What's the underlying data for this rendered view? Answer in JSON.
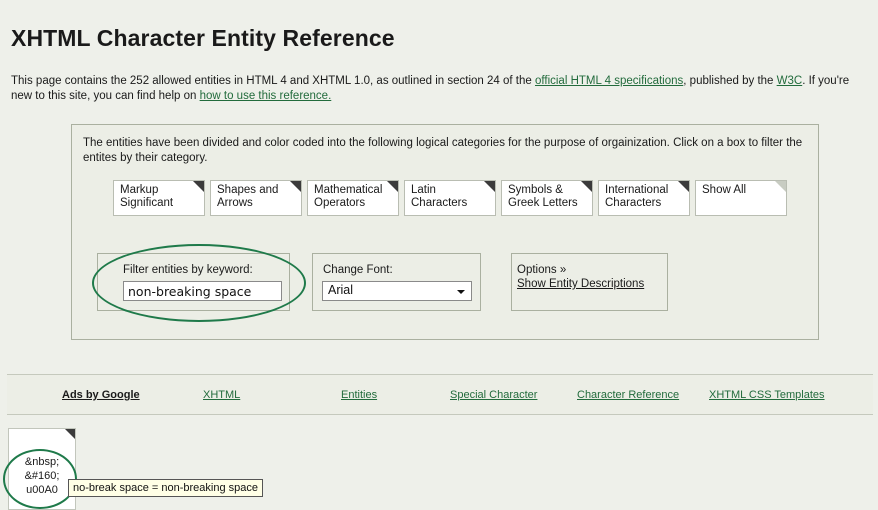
{
  "page": {
    "title": "XHTML Character Entity Reference",
    "intro": {
      "p1": "This page contains the 252 allowed entities in HTML 4 and XHTML 1.0, as outlined in section 24 of the ",
      "link_spec": "official HTML 4 specifications",
      "p2": ", published by the ",
      "link_w3c": "W3C",
      "p3": ". If you're new to this site, you can find help on ",
      "link_help": "how to use this reference.",
      "p4": ""
    }
  },
  "panel": {
    "description": "The entities have been divided and color coded into the following logical categories for the purpose of orgainization. Click on a box to filter the entites by their category.",
    "categories": [
      {
        "line1": "Markup",
        "line2": "Significant"
      },
      {
        "line1": "Shapes and",
        "line2": "Arrows"
      },
      {
        "line1": "Mathematical",
        "line2": "Operators"
      },
      {
        "line1": "Latin",
        "line2": "Characters"
      },
      {
        "line1": "Symbols &",
        "line2": "Greek Letters"
      },
      {
        "line1": "International",
        "line2": "Characters"
      },
      {
        "line1": "Show All",
        "line2": ""
      }
    ],
    "filter": {
      "label": "Filter entities by keyword:",
      "value": "non-breaking space"
    },
    "font": {
      "label": "Change Font:",
      "selected": "Arial"
    },
    "options": {
      "label": "Options »",
      "link": "Show Entity Descriptions"
    }
  },
  "adbar": {
    "label": "Ads by Google",
    "links": [
      "XHTML",
      "Entities",
      "Special Character",
      "Character Reference",
      "XHTML CSS Templates"
    ]
  },
  "entity": {
    "name": "&nbsp;",
    "decimal": "&#160;",
    "unicode": "u00A0",
    "tooltip": "no-break space = non-breaking space"
  },
  "colors": {
    "background": "#eef0ea",
    "link": "#226b3c",
    "highlight_ellipse": "#1f7a4a",
    "corner_marker": "#3b3b3b"
  }
}
